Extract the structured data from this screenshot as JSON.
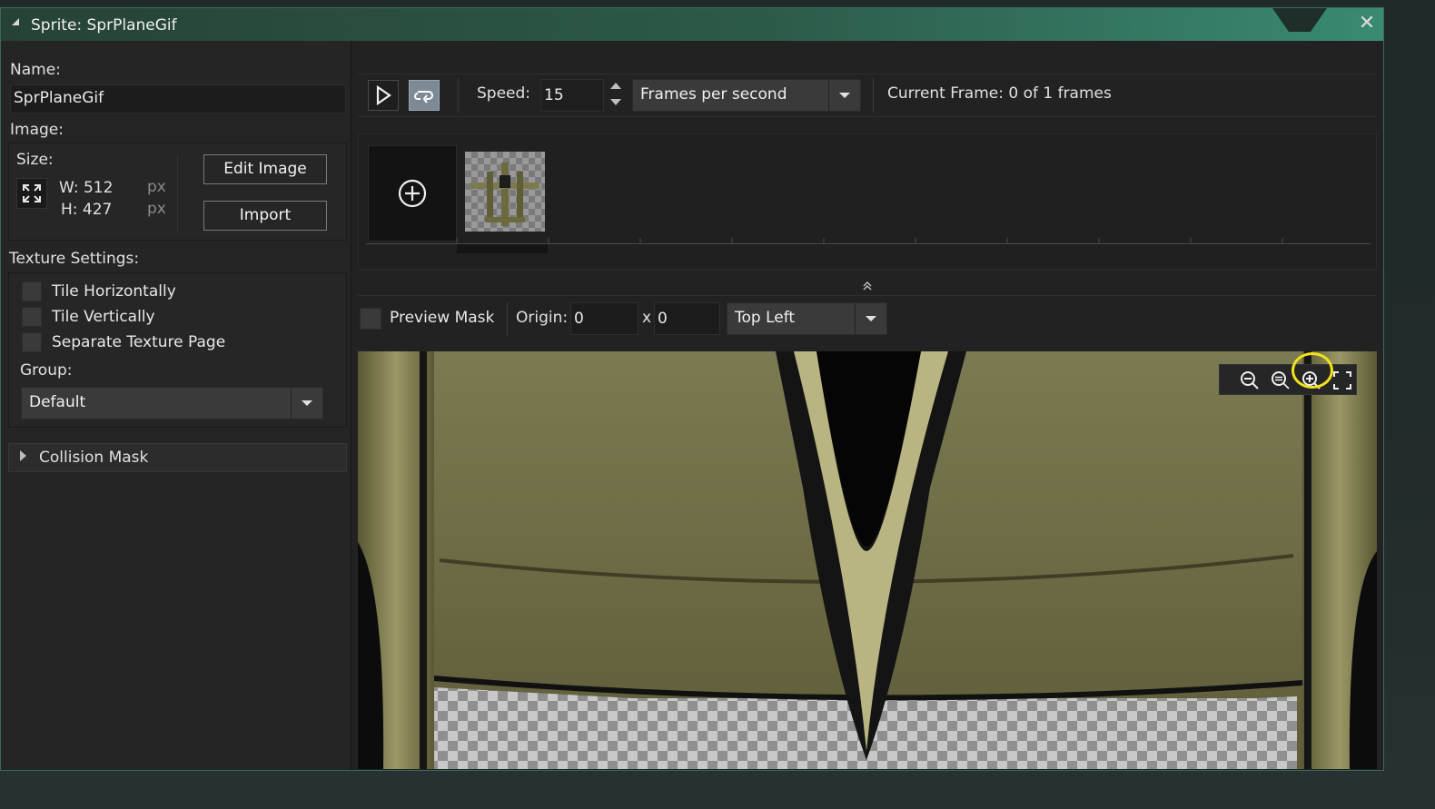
{
  "window": {
    "title": "Sprite: SprPlaneGif",
    "close_icon": "close-icon"
  },
  "left": {
    "name_label": "Name:",
    "name_value": "SprPlaneGif",
    "image_label": "Image:",
    "size_label": "Size:",
    "width_text": "W: 512",
    "height_text": "H: 427",
    "unit": "px",
    "edit_image": "Edit Image",
    "import": "Import",
    "texture_label": "Texture Settings:",
    "tile_h": "Tile Horizontally",
    "tile_v": "Tile Vertically",
    "separate_page": "Separate Texture Page",
    "group_label": "Group:",
    "group_value": "Default",
    "collision_mask": "Collision Mask"
  },
  "toolbar": {
    "speed_label": "Speed:",
    "speed_value": "15",
    "speed_units": "Frames per second",
    "current_frame": "Current Frame: 0 of 1 frames"
  },
  "canvas_bar": {
    "preview_mask": "Preview Mask",
    "origin_label": "Origin:",
    "origin_x": "0",
    "x_sep": "x",
    "origin_y": "0",
    "origin_preset": "Top Left"
  },
  "colors": {
    "accent": "#3a8a72",
    "highlight": "#f0e21a",
    "plane_olive": "#7d7a4e"
  }
}
